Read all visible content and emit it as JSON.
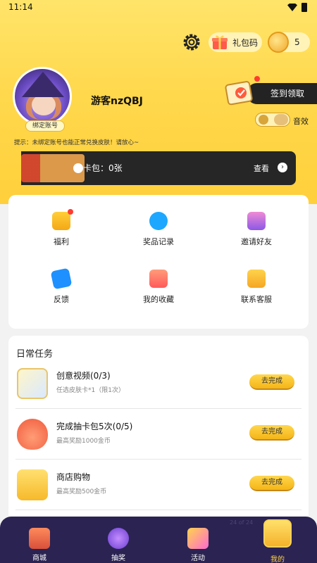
{
  "status_bar": {
    "time": "11:14"
  },
  "header": {
    "gift_code_label": "礼包码",
    "coin_count": "5"
  },
  "profile": {
    "username": "游客nzQBJ",
    "bind_label": "绑定账号",
    "signin_label": "签到领取",
    "sound_label": "音效"
  },
  "tip": "提示：未绑定账号也能正常兑换皮肤！请放心~",
  "card_pack": {
    "label": "卡包：0张",
    "view_label": "查看",
    "view_icon": "›"
  },
  "grid": [
    {
      "label": "福利",
      "icon": "gift-box-icon",
      "badge": true
    },
    {
      "label": "奖品记录",
      "icon": "clock-icon",
      "badge": false
    },
    {
      "label": "邀请好友",
      "icon": "invite-icon",
      "badge": false
    },
    {
      "label": "反馈",
      "icon": "chat-icon",
      "badge": false
    },
    {
      "label": "我的收藏",
      "icon": "collection-icon",
      "badge": false
    },
    {
      "label": "联系客服",
      "icon": "support-icon",
      "badge": false
    }
  ],
  "tasks": {
    "title": "日常任务",
    "items": [
      {
        "title": "创意视频(0/3)",
        "subtitle": "任选皮肤卡*1（限1次）",
        "button": "去完成",
        "icon": "video-card-icon"
      },
      {
        "title": "完成抽卡包5次(0/5)",
        "subtitle": "最高奖励1000金币",
        "button": "去完成",
        "icon": "money-bag-icon"
      },
      {
        "title": "商店购物",
        "subtitle": "最高奖励500金币",
        "button": "去完成",
        "icon": "gift-bow-icon"
      }
    ]
  },
  "nav": {
    "items": [
      {
        "label": "商城",
        "icon": "shop-icon"
      },
      {
        "label": "抽奖",
        "icon": "planet-icon"
      },
      {
        "label": "活动",
        "icon": "party-icon"
      },
      {
        "label": "我的",
        "icon": "profile-crown-icon"
      }
    ],
    "faint_text": "24 of 24"
  },
  "colors": {
    "top_gradient": "#ffd84c",
    "accent_button": "#f5b516",
    "nav_bg": "#2b2352",
    "badge_red": "#ff3b30"
  }
}
